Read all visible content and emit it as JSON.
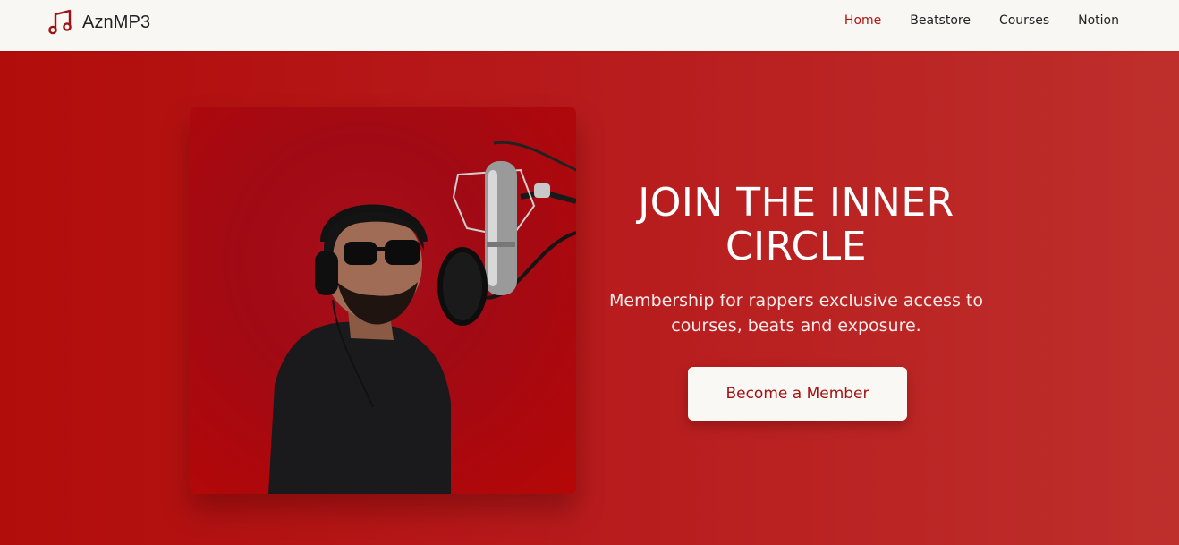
{
  "header": {
    "brand_name": "AznMP3",
    "brand_icon": "music-note-icon",
    "nav": [
      {
        "label": "Home",
        "active": true
      },
      {
        "label": "Beatstore",
        "active": false
      },
      {
        "label": "Courses",
        "active": false
      },
      {
        "label": "Notion",
        "active": false
      }
    ]
  },
  "hero": {
    "title": "JOIN THE INNER CIRCLE",
    "subtitle": "Membership for rappers exclusive access to courses, beats and exposure.",
    "cta_label": "Become a Member"
  },
  "colors": {
    "accent": "#b31212",
    "hero_bg": "#b51818",
    "header_bg": "#f9f7f3",
    "cta_bg": "#faf8f4",
    "cta_text": "#a51212"
  }
}
